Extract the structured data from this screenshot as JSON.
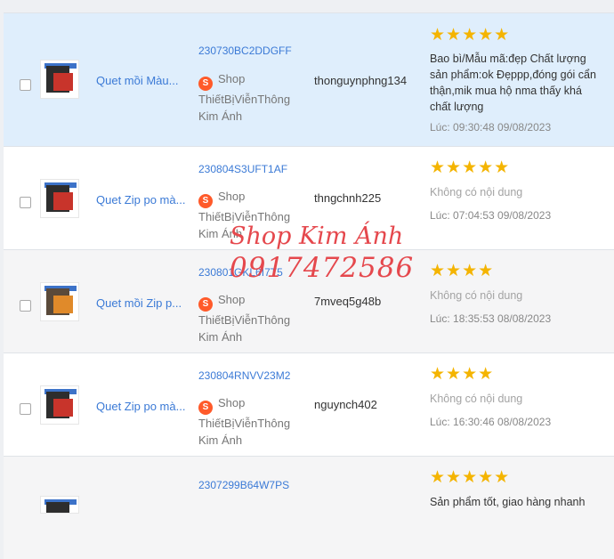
{
  "rows": [
    {
      "product": "Quet mồi Màu...",
      "order_id": "230730BC2DDGFF",
      "shop": [
        "Shop",
        "ThiếtBịViễnThông",
        "Kim Ánh"
      ],
      "username": "thonguynphng134",
      "stars": "★★★★★",
      "rating": 5,
      "review": "Bao bì/Mẫu mã:đẹp Chất lượng sản phẩm:ok Đẹppp,đóng gói cẩn thận,mik mua hộ nma thấy khá chất lượng",
      "time": "Lúc: 09:30:48 09/08/2023"
    },
    {
      "product": "Quet Zip po mà...",
      "order_id": "230804S3UFT1AF",
      "shop": [
        "Shop",
        "ThiếtBịViễnThông",
        "Kim Ánh"
      ],
      "username": "thngchnh225",
      "stars": "★★★★★",
      "rating": 5,
      "review": "Không có nội dung",
      "time": "Lúc: 07:04:53 09/08/2023"
    },
    {
      "product": "Quet mồi Zip p...",
      "order_id": "230801GKL6I7T5",
      "shop": [
        "Shop",
        "ThiếtBịViễnThông",
        "Kim Ánh"
      ],
      "username": "7mveq5g48b",
      "stars": "★★★★",
      "rating": 4,
      "review": "Không có nội dung",
      "time": "Lúc: 18:35:53 08/08/2023"
    },
    {
      "product": "Quet Zip po mà...",
      "order_id": "230804RNVV23M2",
      "shop": [
        "Shop",
        "ThiếtBịViễnThông",
        "Kim Ánh"
      ],
      "username": "nguynch402",
      "stars": "★★★★",
      "rating": 4,
      "review": "Không có nội dung",
      "time": "Lúc: 16:30:46 08/08/2023"
    },
    {
      "order_id": "2307299B64W7PS",
      "stars": "★★★★★",
      "rating": 5,
      "review": "Sản phẩm tốt, giao hàng nhanh"
    }
  ],
  "watermark": {
    "line1": "Shop Kim Ánh",
    "line2": "0917472586"
  },
  "colors": {
    "link": "#3b7ad6",
    "star": "#f4b400",
    "highlight": "#dfeefc",
    "watermark": "#e5484d",
    "shop_icon": "#ff5a2a"
  },
  "icons": {
    "shop": "shopee-bag-icon",
    "star": "star-icon"
  }
}
